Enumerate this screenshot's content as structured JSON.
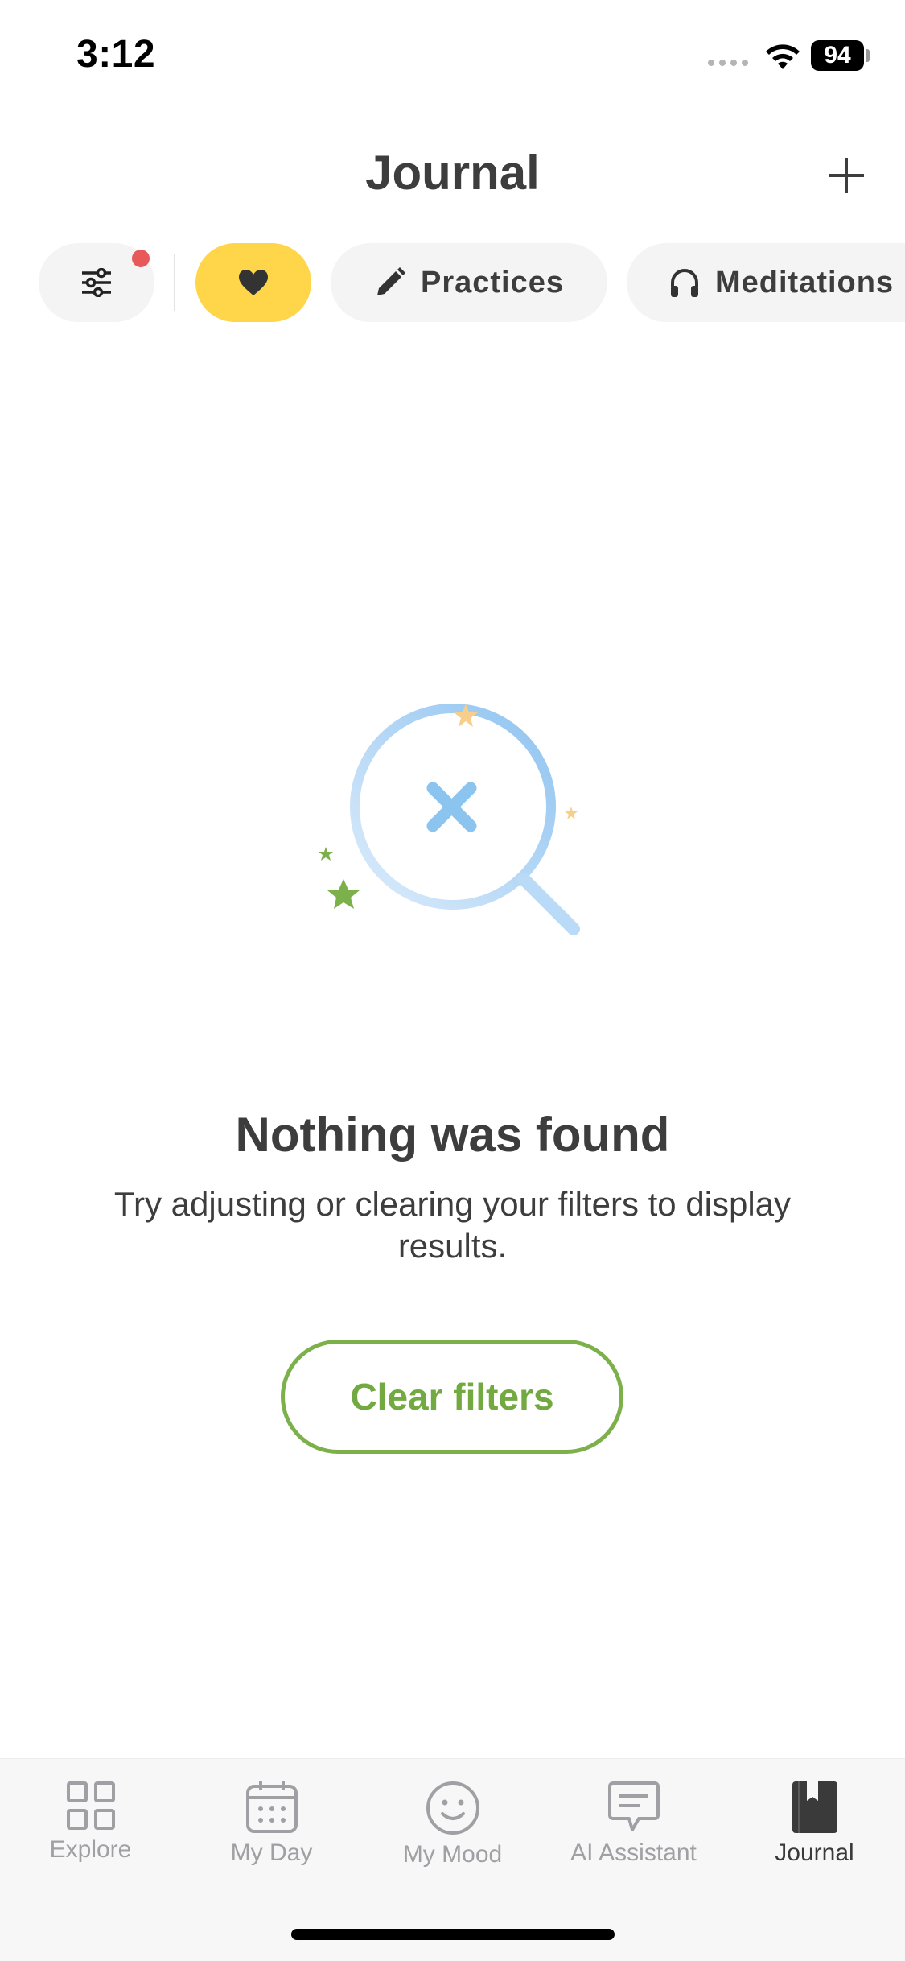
{
  "status_bar": {
    "time": "3:12",
    "battery": "94"
  },
  "header": {
    "title": "Journal",
    "add_icon": "plus-icon"
  },
  "filters": {
    "filter_icon": "sliders-icon",
    "favorites_icon": "heart-icon",
    "chips": [
      {
        "label": "Practices",
        "icon": "pencil-icon"
      },
      {
        "label": "Meditations",
        "icon": "headphones-icon"
      }
    ],
    "active_chip_color": "#ffd54a",
    "indicator_color": "#e85a5a"
  },
  "empty_state": {
    "title": "Nothing was found",
    "message": "Try adjusting or clearing your filters to display results.",
    "button_label": "Clear filters",
    "accent_color": "#72aa41"
  },
  "tab_bar": {
    "tabs": [
      {
        "label": "Explore",
        "icon": "grid-icon",
        "active": false
      },
      {
        "label": "My Day",
        "icon": "calendar-icon",
        "active": false
      },
      {
        "label": "My Mood",
        "icon": "smiley-icon",
        "active": false
      },
      {
        "label": "AI Assistant",
        "icon": "chat-icon",
        "active": false
      },
      {
        "label": "Journal",
        "icon": "journal-icon",
        "active": true
      }
    ]
  }
}
